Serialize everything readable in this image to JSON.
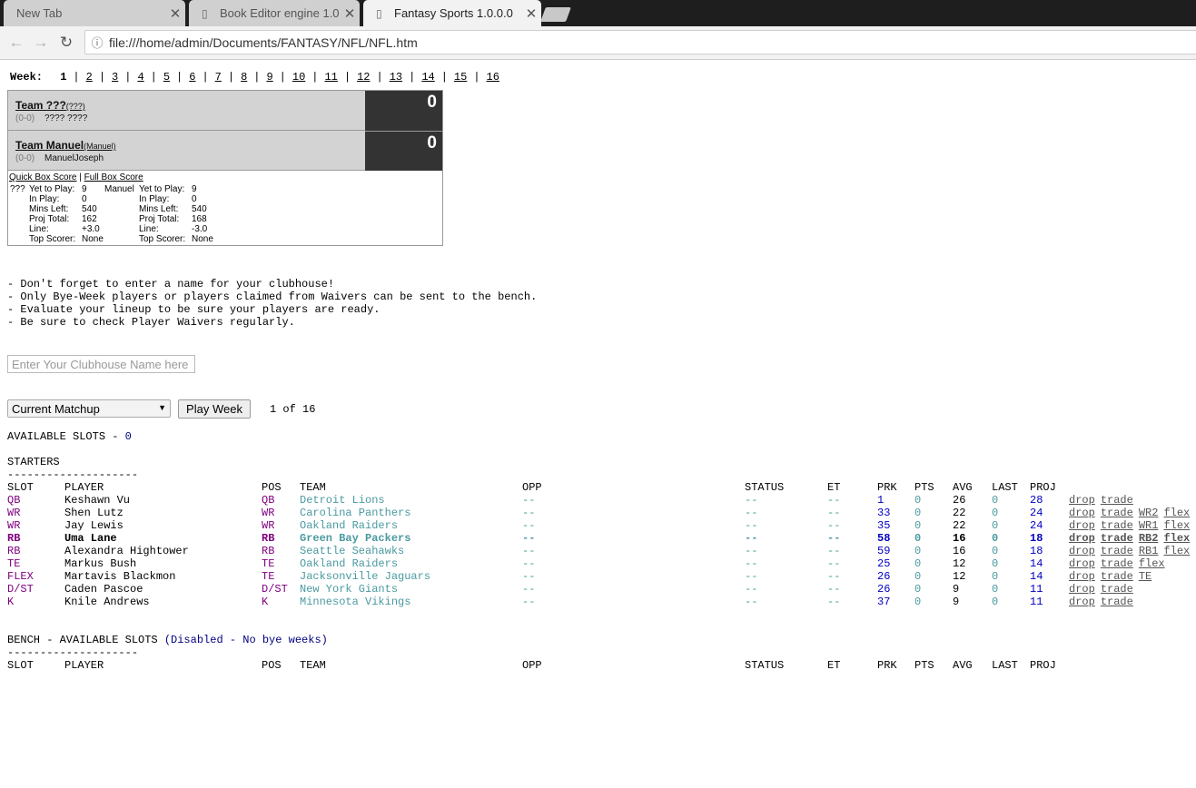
{
  "browser": {
    "tabs": [
      {
        "label": "New Tab"
      },
      {
        "label": "Book Editor engine 1.0"
      },
      {
        "label": "Fantasy Sports 1.0.0.0"
      }
    ],
    "url": "file:///home/admin/Documents/FANTASY/NFL/NFL.htm"
  },
  "weeks": {
    "label": "Week:",
    "items": [
      "1",
      "2",
      "3",
      "4",
      "5",
      "6",
      "7",
      "8",
      "9",
      "10",
      "11",
      "12",
      "13",
      "14",
      "15",
      "16"
    ],
    "current": "1"
  },
  "scoreboard": {
    "teams": [
      {
        "name": "Team ???",
        "abbr": "(???)",
        "record": "(0-0)",
        "owner": "???? ????",
        "score": "0"
      },
      {
        "name": "Team Manuel",
        "abbr": "(Manuel)",
        "record": "(0-0)",
        "owner": "ManuelJoseph",
        "score": "0"
      }
    ],
    "links": {
      "quick": "Quick Box Score",
      "sep": "|",
      "full": "Full Box Score"
    },
    "stat_labels": [
      "Yet to Play:",
      "In Play:",
      "Mins Left:",
      "Proj Total:",
      "Line:",
      "Top Scorer:"
    ],
    "stats": [
      {
        "abbr": "???",
        "values": [
          "9",
          "0",
          "540",
          "162",
          "+3.0",
          "None"
        ]
      },
      {
        "abbr": "Manuel",
        "values": [
          "9",
          "0",
          "540",
          "168",
          "-3.0",
          "None"
        ]
      }
    ]
  },
  "notes": [
    "- Don't forget to enter a name for your clubhouse!",
    "- Only Bye-Week players or players claimed from Waivers can be sent to the bench.",
    "- Evaluate your lineup to be sure your players are ready.",
    "- Be sure to check Player Waivers regularly."
  ],
  "clubhouse": {
    "placeholder": "Enter Your Clubhouse Name here"
  },
  "controls": {
    "matchup": "Current Matchup",
    "play_button": "Play Week",
    "week_count": "1 of 16"
  },
  "available": {
    "label": "AVAILABLE SLOTS - ",
    "count": "0"
  },
  "starters_label": "STARTERS",
  "divider": "--------------------",
  "columns": [
    "SLOT",
    "PLAYER",
    "POS",
    "TEAM",
    "OPP",
    "STATUS",
    "ET",
    "PRK",
    "PTS",
    "AVG",
    "LAST",
    "PROJ"
  ],
  "starters": [
    {
      "slot": "QB",
      "player": "Keshawn Vu",
      "pos": "QB",
      "team": "Detroit Lions",
      "opp": "--",
      "status": "--",
      "et": "--",
      "prk": "1",
      "pts": "0",
      "avg": "26",
      "last": "0",
      "proj": "28",
      "actions": [
        "drop",
        "trade"
      ]
    },
    {
      "slot": "WR",
      "player": "Shen Lutz",
      "pos": "WR",
      "team": "Carolina Panthers",
      "opp": "--",
      "status": "--",
      "et": "--",
      "prk": "33",
      "pts": "0",
      "avg": "22",
      "last": "0",
      "proj": "24",
      "actions": [
        "drop",
        "trade",
        "WR2",
        "flex"
      ]
    },
    {
      "slot": "WR",
      "player": "Jay Lewis",
      "pos": "WR",
      "team": "Oakland Raiders",
      "opp": "--",
      "status": "--",
      "et": "--",
      "prk": "35",
      "pts": "0",
      "avg": "22",
      "last": "0",
      "proj": "24",
      "actions": [
        "drop",
        "trade",
        "WR1",
        "flex"
      ]
    },
    {
      "slot": "RB",
      "player": "Uma Lane",
      "pos": "RB",
      "team": "Green Bay Packers",
      "opp": "--",
      "status": "--",
      "et": "--",
      "prk": "58",
      "pts": "0",
      "avg": "16",
      "last": "0",
      "proj": "18",
      "actions": [
        "drop",
        "trade",
        "RB2",
        "flex"
      ]
    },
    {
      "slot": "RB",
      "player": "Alexandra Hightower",
      "pos": "RB",
      "team": "Seattle Seahawks",
      "opp": "--",
      "status": "--",
      "et": "--",
      "prk": "59",
      "pts": "0",
      "avg": "16",
      "last": "0",
      "proj": "18",
      "actions": [
        "drop",
        "trade",
        "RB1",
        "flex"
      ]
    },
    {
      "slot": "TE",
      "player": "Markus Bush",
      "pos": "TE",
      "team": "Oakland Raiders",
      "opp": "--",
      "status": "--",
      "et": "--",
      "prk": "25",
      "pts": "0",
      "avg": "12",
      "last": "0",
      "proj": "14",
      "actions": [
        "drop",
        "trade",
        "flex"
      ]
    },
    {
      "slot": "FLEX",
      "player": "Martavis Blackmon",
      "pos": "TE",
      "team": "Jacksonville Jaguars",
      "opp": "--",
      "status": "--",
      "et": "--",
      "prk": "26",
      "pts": "0",
      "avg": "12",
      "last": "0",
      "proj": "14",
      "actions": [
        "drop",
        "trade",
        "TE"
      ]
    },
    {
      "slot": "D/ST",
      "player": "Caden Pascoe",
      "pos": "D/ST",
      "team": "New York Giants",
      "opp": "--",
      "status": "--",
      "et": "--",
      "prk": "26",
      "pts": "0",
      "avg": "9",
      "last": "0",
      "proj": "11",
      "actions": [
        "drop",
        "trade"
      ]
    },
    {
      "slot": "K",
      "player": "Knile Andrews",
      "pos": "K",
      "team": "Minnesota Vikings",
      "opp": "--",
      "status": "--",
      "et": "--",
      "prk": "37",
      "pts": "0",
      "avg": "9",
      "last": "0",
      "proj": "11",
      "actions": [
        "drop",
        "trade"
      ]
    }
  ],
  "selected_row": 3,
  "bench": {
    "label": "BENCH - AVAILABLE SLOTS ",
    "note": "(Disabled - No bye weeks)"
  }
}
